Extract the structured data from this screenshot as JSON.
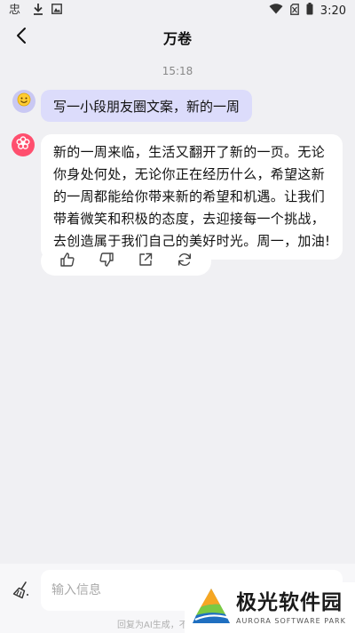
{
  "status_bar": {
    "time": "3:20",
    "left_icons": [
      "app-notification-icon",
      "download-icon",
      "image-icon"
    ],
    "right_icons": [
      "wifi-icon",
      "no-sim-icon",
      "battery-icon"
    ]
  },
  "header": {
    "title": "万卷",
    "back_icon": "chevron-left-icon"
  },
  "chat": {
    "timestamp": "15:18",
    "user_message": "写一小段朋友圈文案，新的一周",
    "bot_message": "新的一周来临，生活又翻开了新的一页。无论你身处何处，无论你正在经历什么，希望这新的一周都能给你带来新的希望和机遇。让我们带着微笑和积极的态度，去迎接每一个挑战，去创造属于我们自己的美好时光。周一，加油!",
    "actions": [
      "thumbs-up-icon",
      "thumbs-down-icon",
      "share-icon",
      "regenerate-icon"
    ]
  },
  "input": {
    "placeholder": "输入信息",
    "value": "",
    "disclaimer": "回复为AI生成，不"
  },
  "watermark": {
    "cn": "极光软件园",
    "en": "AURORA SOFTWARE PARK"
  },
  "colors": {
    "background": "#f0f0f3",
    "user_bubble": "#dcdcfb",
    "bot_avatar": "#ff4f6e",
    "user_avatar": "#c9c8f3"
  }
}
